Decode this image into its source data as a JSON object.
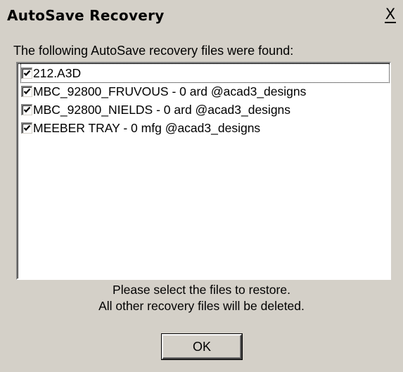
{
  "window": {
    "title": "AutoSave Recovery",
    "close_glyph": "X"
  },
  "prompt": "The following AutoSave recovery files were found:",
  "files": [
    {
      "label": "212.A3D",
      "checked": true,
      "focused": true
    },
    {
      "label": "MBC_92800_FRUVOUS - 0 ard @acad3_designs",
      "checked": true,
      "focused": false
    },
    {
      "label": "MBC_92800_NIELDS - 0 ard @acad3_designs",
      "checked": true,
      "focused": false
    },
    {
      "label": "MEEBER TRAY - 0 mfg @acad3_designs",
      "checked": true,
      "focused": false
    }
  ],
  "footer": {
    "line1": "Please select the files to restore.",
    "line2": "All other recovery files will be deleted."
  },
  "buttons": {
    "ok_label": "OK"
  },
  "icons": {
    "close": "close-icon",
    "check": "checkmark-icon"
  },
  "colors": {
    "face": "#d4d0c8",
    "list_background": "#ffffff",
    "text": "#000000"
  }
}
